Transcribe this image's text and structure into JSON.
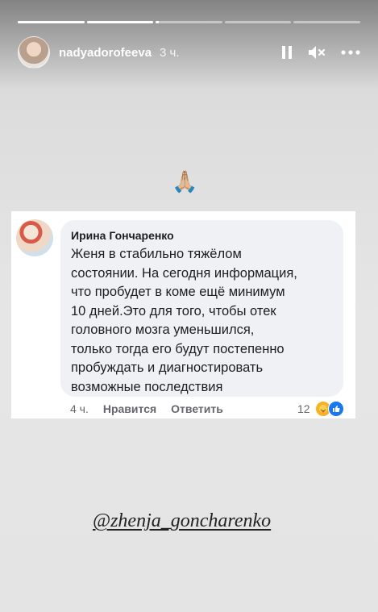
{
  "story": {
    "progress": [
      1,
      1,
      0.05,
      0,
      0
    ],
    "username": "nadyadorofeeva",
    "time": "3 ч.",
    "icons": {
      "pause": "pause-icon",
      "mute": "mute-icon",
      "more": "more-icon"
    }
  },
  "emoji": "🙏🏼",
  "comment": {
    "author": "Ирина Гончаренко",
    "text": "Женя в стабильно тяжёлом\nсостоянии. На сегодня информация,\nчто пробудет в коме ещё минимум\n10 дней.Это для того, чтобы отек\nголовного мозга уменьшился,\nтолько тогда его будут постепенно\nпробуждать и диагностировать\nвозможные последствия",
    "time": "4 ч.",
    "like_label": "Нравится",
    "reply_label": "Ответить",
    "reaction_count": "12",
    "reaction_icons": [
      "care-reaction-icon",
      "like-reaction-icon"
    ]
  },
  "mention": "@zhenja_goncharenko"
}
